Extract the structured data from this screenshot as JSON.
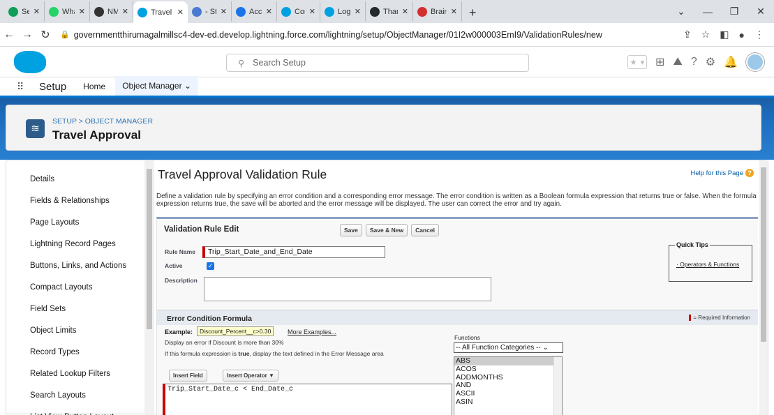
{
  "browser": {
    "tabs": [
      {
        "label": "Search s",
        "color": "#0f9d58"
      },
      {
        "label": "WhatsAp",
        "color": "#25d366"
      },
      {
        "label": "NM_Arti",
        "color": "#333333"
      },
      {
        "label": "Travel Ap",
        "color": "#00a1e0",
        "active": true
      },
      {
        "label": "- Studen",
        "color": "#4a7bd0"
      },
      {
        "label": "Accessib",
        "color": "#1a73e8"
      },
      {
        "label": "Contract",
        "color": "#00a1e0"
      },
      {
        "label": "Login | S",
        "color": "#00a1e0"
      },
      {
        "label": "Thamizh",
        "color": "#24292e"
      },
      {
        "label": "Brainsto",
        "color": "#d32f2f"
      }
    ],
    "url": "governmentthirumagalmillsc4-dev-ed.develop.lightning.force.com/lightning/setup/ObjectManager/01I2w000003EmI9/ValidationRules/new"
  },
  "header": {
    "search_placeholder": "Search Setup"
  },
  "nav": {
    "app_title": "Setup",
    "home": "Home",
    "object_manager": "Object Manager"
  },
  "object": {
    "breadcrumb": "SETUP > OBJECT MANAGER",
    "name": "Travel Approval"
  },
  "sidebar": {
    "items": [
      "Details",
      "Fields & Relationships",
      "Page Layouts",
      "Lightning Record Pages",
      "Buttons, Links, and Actions",
      "Compact Layouts",
      "Field Sets",
      "Object Limits",
      "Record Types",
      "Related Lookup Filters",
      "Search Layouts",
      "List View Button Layout"
    ]
  },
  "main": {
    "title": "Travel Approval Validation Rule",
    "help_link": "Help for this Page",
    "description": "Define a validation rule by specifying an error condition and a corresponding error message. The error condition is written as a Boolean formula expression that returns true or false. When the formula expression returns true, the save will be aborted and the error message will be displayed. The user can correct the error and try again."
  },
  "edit": {
    "heading": "Validation Rule Edit",
    "save": "Save",
    "save_new": "Save & New",
    "cancel": "Cancel",
    "rule_name_label": "Rule Name",
    "rule_name_value": "Trip_Start_Date_and_End_Date",
    "active_label": "Active",
    "active": true,
    "description_label": "Description",
    "quick_tips": "Quick Tips",
    "operators_link": "Operators & Functions"
  },
  "formula": {
    "section_title": "Error Condition Formula",
    "required_info": "= Required Information",
    "example_label": "Example:",
    "example_code": "Discount_Percent__c>0.30",
    "more_examples": "More Examples...",
    "hint1": "Display an error if Discount is more than 30%",
    "hint2_pre": "If this formula expression is ",
    "hint2_bold": "true",
    "hint2_post": ", display the text defined in the Error Message area",
    "insert_field": "Insert Field",
    "insert_operator": "Insert Operator ▼",
    "functions_label": "Functions",
    "function_category": "-- All Function Categories --",
    "functions": [
      "ABS",
      "ACOS",
      "ADDMONTHS",
      "AND",
      "ASCII",
      "ASIN"
    ],
    "expression": "Trip_Start_Date_c < End_Date_c"
  }
}
